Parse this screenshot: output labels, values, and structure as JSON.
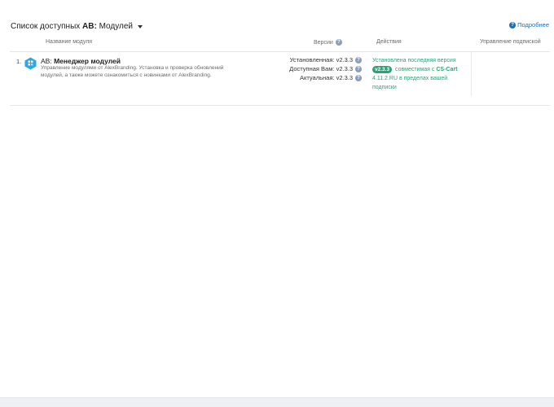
{
  "header": {
    "title_prefix": "Список доступных ",
    "title_bold": "AB:",
    "title_suffix": " Модулей",
    "more_link": "Подробнее"
  },
  "table": {
    "columns": {
      "name": "Название модуля",
      "versions": "Версии",
      "actions": "Действия",
      "subscription": "Управление подпиской"
    },
    "rows": [
      {
        "index": "1.",
        "name_prefix": "AB: ",
        "name_bold": "Менеджер модулей",
        "description": "Управление модулями от AlexBranding. Установка и проверка обновлений модулей, а также можете ознакомиться с новинками от AlexBranding.",
        "versions": {
          "installed_label": "Установленная:",
          "installed_value": "v2.3.3",
          "available_label": "Доступная Вам:",
          "available_value": "v2.3.3",
          "current_label": "Актуальная:",
          "current_value": "v2.3.3"
        },
        "actions": {
          "line1": "Установлена последняя версия",
          "badge": "v2.3.3",
          "compat_text": "совместимая с",
          "platform": "CS-Cart",
          "platform_version": "4.11.2.RU",
          "tail": "в пределах вашей подписки"
        }
      }
    ]
  },
  "colors": {
    "accent": "#1d6fb8",
    "success": "#2aa476",
    "icon": "#29a9e1"
  },
  "icons": {
    "help": "question-circle-icon",
    "module": "module-hexagon-icon",
    "dropdown": "caret-down-icon"
  }
}
